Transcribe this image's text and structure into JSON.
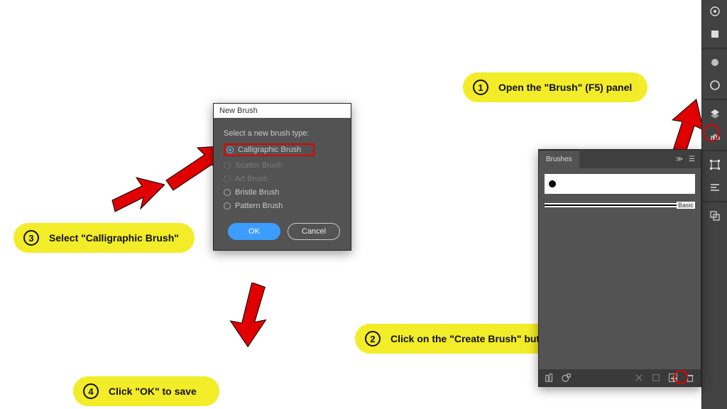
{
  "callouts": {
    "c1": {
      "num": "1",
      "text": "Open the \"Brush\" (F5) panel"
    },
    "c2": {
      "num": "2",
      "text": "Click on the \"Create Brush\" button"
    },
    "c3": {
      "num": "3",
      "text": "Select \"Calligraphic Brush\""
    },
    "c4": {
      "num": "4",
      "text": "Click \"OK\" to save"
    }
  },
  "dialog": {
    "title": "New Brush",
    "prompt": "Select a new brush type:",
    "options": {
      "calligraphic": "Calligraphic Brush",
      "scatter": "Scatter Brush",
      "art": "Art Brush",
      "bristle": "Bristle Brush",
      "pattern": "Pattern Brush"
    },
    "ok": "OK",
    "cancel": "Cancel"
  },
  "brushes_panel": {
    "tab": "Brushes",
    "basic_label": "Basic"
  }
}
